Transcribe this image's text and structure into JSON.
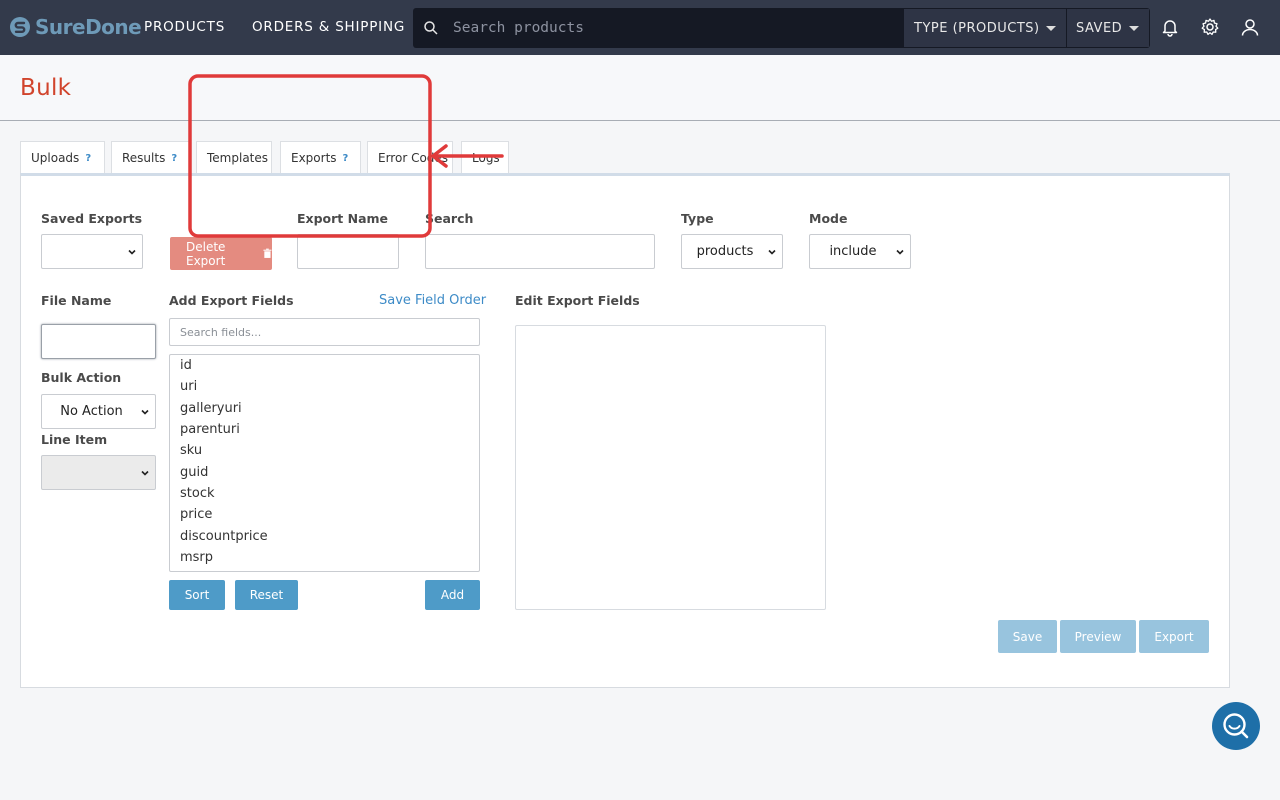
{
  "brand": {
    "logo_text": "SureDone",
    "accent": "#6e9ab8"
  },
  "nav": {
    "products": "PRODUCTS",
    "orders_shipping": "ORDERS & SHIPPING",
    "search_placeholder": "Search products",
    "type_dropdown": "TYPE (PRODUCTS)",
    "saved_dropdown": "SAVED"
  },
  "page": {
    "title": "Bulk",
    "title_color": "#d1442c"
  },
  "tabs": [
    {
      "label": "Uploads",
      "help": "?"
    },
    {
      "label": "Results",
      "help": "?"
    },
    {
      "label": "Templates"
    },
    {
      "label": "Exports",
      "help": "?"
    },
    {
      "label": "Error Codes"
    },
    {
      "label": "Logs"
    }
  ],
  "form": {
    "saved_exports_label": "Saved Exports",
    "saved_exports_value": "",
    "delete_export": "Delete Export",
    "export_name_label": "Export Name",
    "search_label": "Search",
    "type_label": "Type",
    "type_value": "products",
    "mode_label": "Mode",
    "mode_value": "include",
    "file_name_label": "File Name",
    "bulk_action_label": "Bulk Action",
    "bulk_action_value": "No Action",
    "line_item_label": "Line Item",
    "line_item_value": "",
    "add_fields_label": "Add Export Fields",
    "save_field_order": "Save Field Order",
    "field_search_placeholder": "Search fields...",
    "fields": [
      "id",
      "uri",
      "galleryuri",
      "parenturi",
      "sku",
      "guid",
      "stock",
      "price",
      "discountprice",
      "msrp"
    ],
    "sort": "Sort",
    "reset": "Reset",
    "add": "Add",
    "edit_fields_label": "Edit Export Fields",
    "save": "Save",
    "preview": "Preview",
    "export": "Export"
  }
}
